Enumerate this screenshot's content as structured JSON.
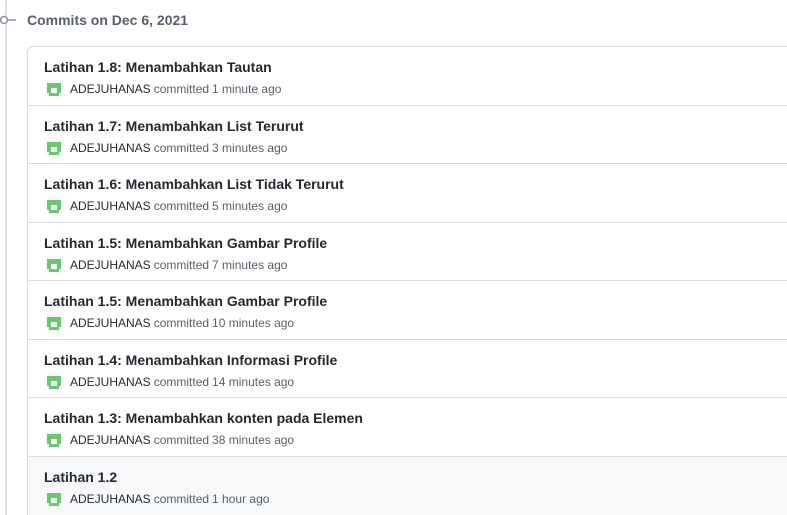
{
  "group": {
    "heading": "Commits on Dec 6, 2021"
  },
  "commits": [
    {
      "title": "Latihan 1.8: Menambahkan Tautan",
      "author": "ADEJUHANAS",
      "action": "committed",
      "time": "1 minute ago"
    },
    {
      "title": "Latihan 1.7: Menambahkan List Terurut",
      "author": "ADEJUHANAS",
      "action": "committed",
      "time": "3 minutes ago"
    },
    {
      "title": "Latihan 1.6: Menambahkan List Tidak Terurut",
      "author": "ADEJUHANAS",
      "action": "committed",
      "time": "5 minutes ago"
    },
    {
      "title": "Latihan 1.5: Menambahkan Gambar Profile",
      "author": "ADEJUHANAS",
      "action": "committed",
      "time": "7 minutes ago"
    },
    {
      "title": "Latihan 1.5: Menambahkan Gambar Profile",
      "author": "ADEJUHANAS",
      "action": "committed",
      "time": "10 minutes ago"
    },
    {
      "title": "Latihan 1.4: Menambahkan Informasi Profile",
      "author": "ADEJUHANAS",
      "action": "committed",
      "time": "14 minutes ago"
    },
    {
      "title": "Latihan 1.3: Menambahkan konten pada Elemen",
      "author": "ADEJUHANAS",
      "action": "committed",
      "time": "38 minutes ago"
    },
    {
      "title": "Latihan 1.2",
      "author": "ADEJUHANAS",
      "action": "committed",
      "time": "1 hour ago"
    }
  ],
  "colors": {
    "avatar": "#6cc56f",
    "row_highlight": "#f6f8fa"
  },
  "icons": {
    "timeline": "git-commit-icon",
    "avatar": "identicon-avatar"
  }
}
